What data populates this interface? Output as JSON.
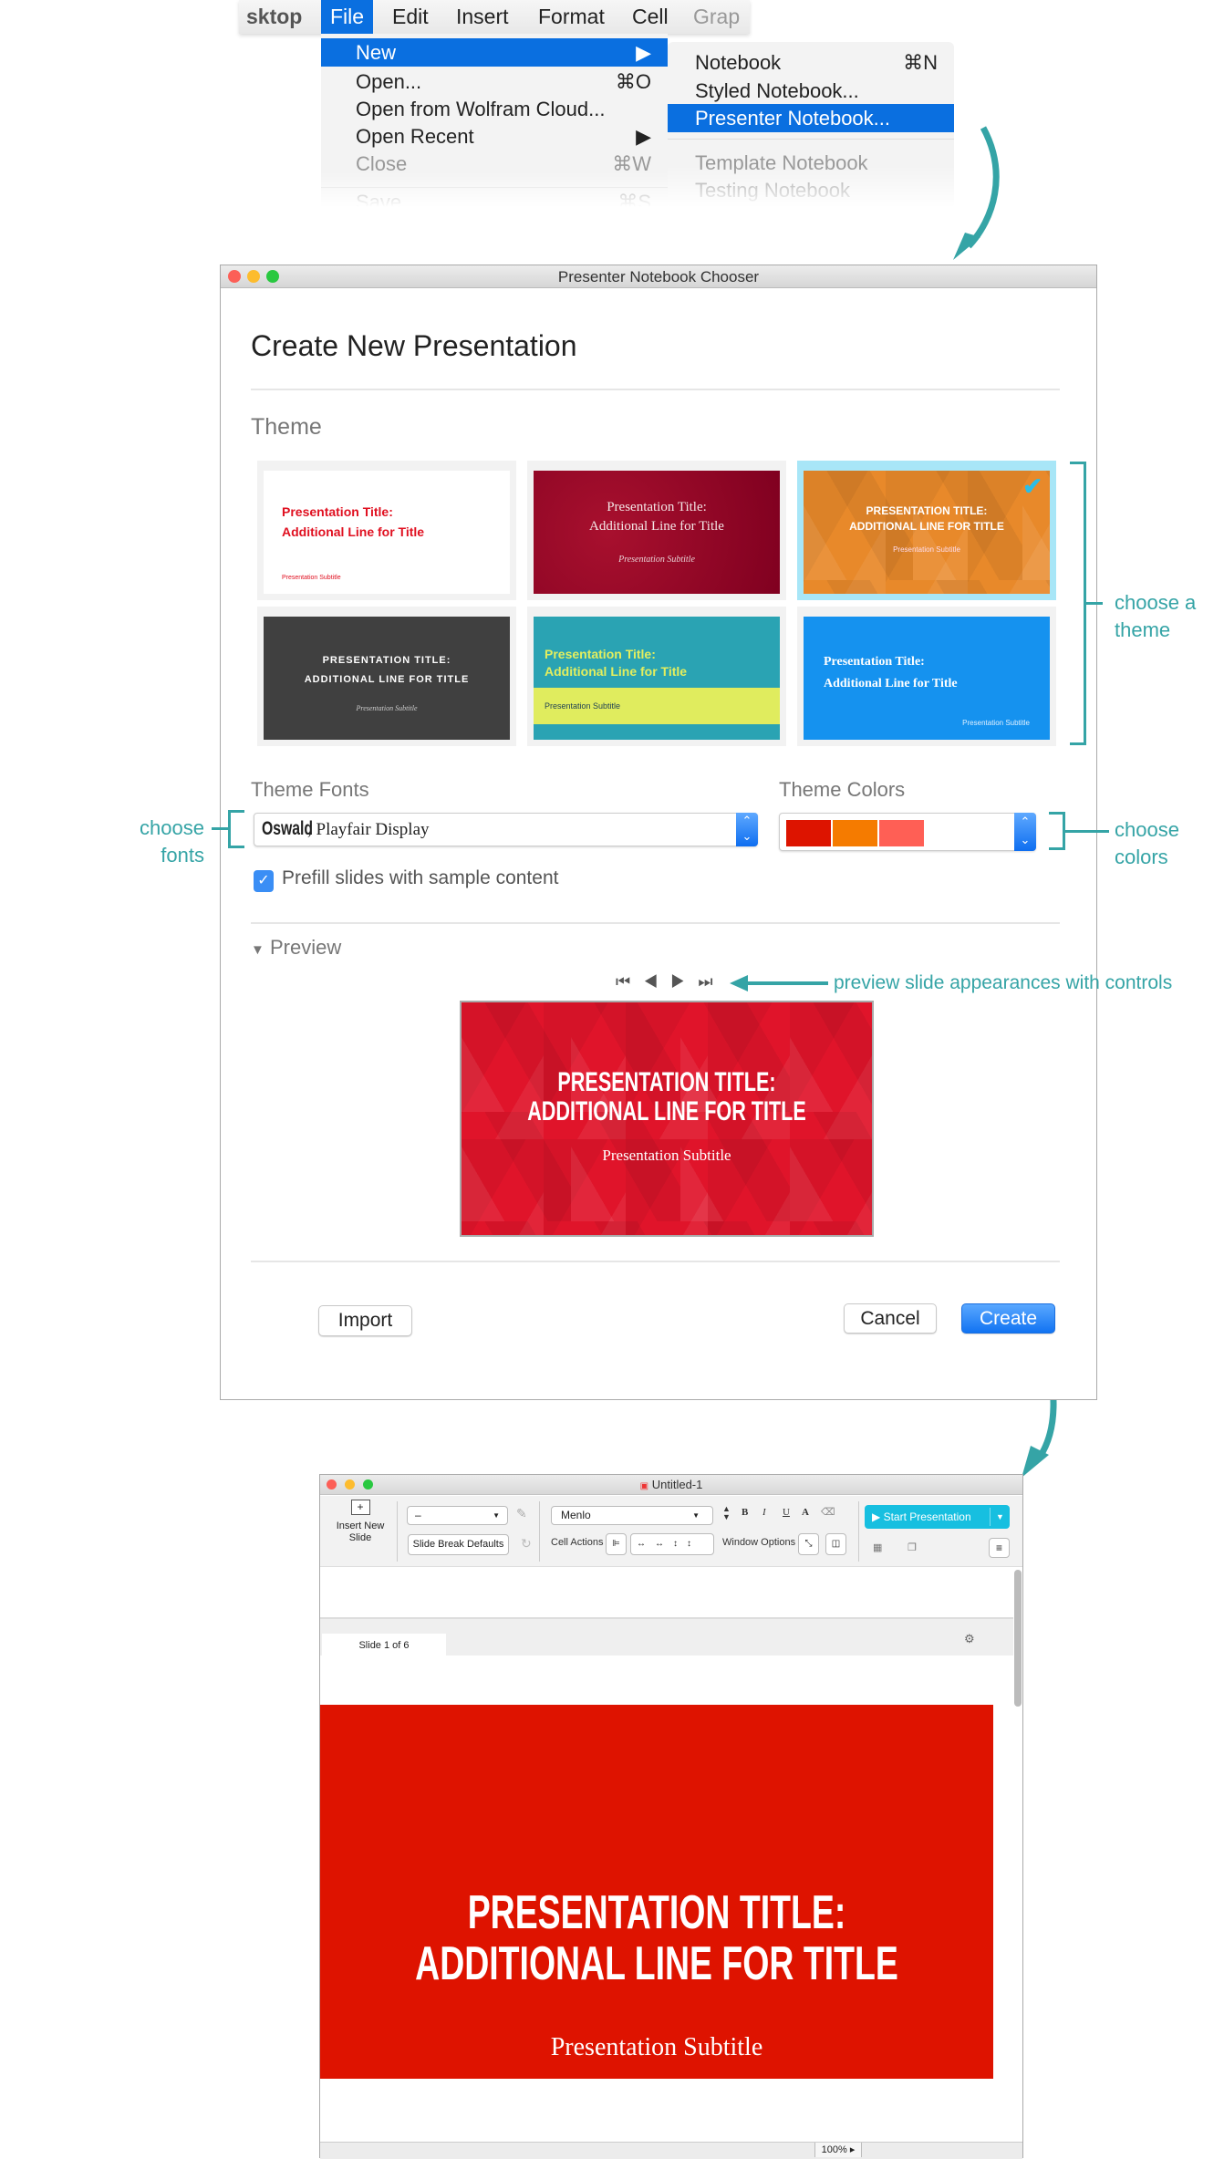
{
  "menubar": {
    "items": [
      "sktop",
      "File",
      "Edit",
      "Insert",
      "Format",
      "Cell",
      "Grap"
    ],
    "selected": "File"
  },
  "file_menu": {
    "items": [
      {
        "label": "New",
        "shortcut": "▶",
        "selected": true
      },
      {
        "label": "Open...",
        "shortcut": "⌘O"
      },
      {
        "label": "Open from Wolfram Cloud...",
        "shortcut": ""
      },
      {
        "label": "Open Recent",
        "shortcut": "▶"
      },
      {
        "label": "Close",
        "shortcut": "⌘W",
        "disabled": true
      },
      {
        "label": "Save",
        "shortcut": "⌘S",
        "disabled": true
      }
    ]
  },
  "new_submenu": {
    "items": [
      {
        "label": "Notebook",
        "shortcut": "⌘N"
      },
      {
        "label": "Styled Notebook...",
        "shortcut": ""
      },
      {
        "label": "Presenter Notebook...",
        "shortcut": "",
        "selected": true
      },
      {
        "label": "Template Notebook",
        "shortcut": "",
        "disabled": true
      },
      {
        "label": "Testing Notebook",
        "shortcut": "",
        "disabled": true
      }
    ]
  },
  "dialog": {
    "window_title": "Presenter Notebook Chooser",
    "heading": "Create New Presentation",
    "theme_label": "Theme",
    "themes": [
      {
        "title1": "Presentation Title:",
        "title2": "Additional Line for Title",
        "subtitle": "Presentation Subtitle",
        "bg": "#ffffff",
        "fg": "#e01020"
      },
      {
        "title1": "Presentation Title:",
        "title2": "Additional Line for Title",
        "subtitle": "Presentation Subtitle",
        "bg": "#8c0a24",
        "fg": "#f4e6e6"
      },
      {
        "title1": "PRESENTATION TITLE:",
        "title2": "ADDITIONAL LINE FOR TITLE",
        "subtitle": "Presentation Subtitle",
        "bg": "#e8892a",
        "fg": "#ffffff",
        "selected": true
      },
      {
        "title1": "PRESENTATION TITLE:",
        "title2": "ADDITIONAL LINE FOR TITLE",
        "subtitle": "Presentation Subtitle",
        "bg": "#404040",
        "fg": "#ffffff"
      },
      {
        "title1": "Presentation Title:",
        "title2": "Additional Line for Title",
        "subtitle": "Presentation Subtitle",
        "bg": "#2aa3b3",
        "fg": "#e3ee5e"
      },
      {
        "title1": "Presentation Title:",
        "title2": "Additional Line for Title",
        "subtitle": "Presentation Subtitle",
        "bg": "#1592ef",
        "fg": "#ffffff"
      }
    ],
    "fonts_label": "Theme Fonts",
    "fonts_value_primary": "Oswald",
    "fonts_value_secondary": ", Playfair Display",
    "colors_label": "Theme Colors",
    "theme_colors": [
      "#dd1400",
      "#f57b00",
      "#ff5f55"
    ],
    "prefill_label": "Prefill slides with sample content",
    "prefill_checked": true,
    "preview_label": "Preview",
    "preview_controls": [
      "first",
      "previous",
      "next",
      "last"
    ],
    "preview": {
      "title1": "PRESENTATION TITLE:",
      "title2": "ADDITIONAL LINE FOR TITLE",
      "subtitle": "Presentation Subtitle"
    },
    "import_label": "Import",
    "cancel_label": "Cancel",
    "create_label": "Create"
  },
  "annotations": {
    "theme": [
      "choose a",
      "theme"
    ],
    "fonts": [
      "choose",
      "fonts"
    ],
    "colors": [
      "choose",
      "colors"
    ],
    "preview": "preview slide appearances with controls"
  },
  "notebook": {
    "window_title": "Untitled-1",
    "insert_slide_label": "Insert New Slide",
    "style_value": "–",
    "slide_break_label": "Slide Break Defaults",
    "font_value": "Menlo",
    "format_buttons": [
      "B",
      "I",
      "U",
      "A"
    ],
    "cell_actions_label": "Cell Actions",
    "window_options_label": "Window Options",
    "start_presentation_label": "Start Presentation",
    "slide_tab_label": "Slide 1 of 6",
    "slide": {
      "title1": "PRESENTATION TITLE:",
      "title2": "ADDITIONAL LINE FOR TITLE",
      "subtitle": "Presentation Subtitle",
      "bg": "#de1300"
    },
    "zoom": "100%"
  },
  "colors": {
    "accent": "#0a6fe0",
    "annotation": "#35a4a6"
  }
}
